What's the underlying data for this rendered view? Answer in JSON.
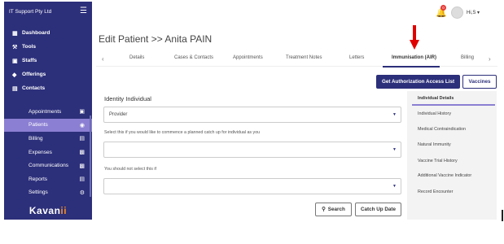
{
  "sidebar": {
    "org_name": "IT Support Pty Ltd",
    "top_items": [
      {
        "label": "Dashboard",
        "icon": "grid-icon"
      },
      {
        "label": "Tools",
        "icon": "wrench-icon"
      },
      {
        "label": "Staffs",
        "icon": "person-icon"
      },
      {
        "label": "Offerings",
        "icon": "box-icon"
      },
      {
        "label": "Contacts",
        "icon": "contact-icon"
      }
    ],
    "sub_items": [
      {
        "label": "Appointments",
        "icon": "calendar-icon",
        "active": false
      },
      {
        "label": "Patients",
        "icon": "users-icon",
        "active": true
      },
      {
        "label": "Billing",
        "icon": "card-icon",
        "active": false
      },
      {
        "label": "Expenses",
        "icon": "wallet-icon",
        "active": false
      },
      {
        "label": "Communications",
        "icon": "chat-icon",
        "active": false
      },
      {
        "label": "Reports",
        "icon": "report-icon",
        "active": false
      },
      {
        "label": "Settings",
        "icon": "gear-icon",
        "active": false
      }
    ],
    "logo_main": "Kavan",
    "logo_accent": "ii"
  },
  "header": {
    "notification_count": "0",
    "user_initials": "Hi,S"
  },
  "page": {
    "title": "Edit Patient >> Anita PAIN"
  },
  "tabs": [
    "Details",
    "Cases & Contacts",
    "Appointments",
    "Treatment Notes",
    "Letters",
    "Immunisation (AIR)",
    "Billing"
  ],
  "buttons": {
    "authorization": "Get Authorization Access List",
    "vaccines": "Vaccines",
    "search": "Search",
    "catch_up": "Catch Up Date"
  },
  "form": {
    "heading": "Identity Individual",
    "select1_value": "Provider",
    "help2": "Select this if you would like to commence a planned catch up for individual as you",
    "help3": "You should not select this if"
  },
  "right_panel": [
    "Individual Details",
    "Individual History",
    "Medical Contraindication",
    "Natural Immunity",
    "Vaccine Trial History",
    "Additional Vaccine Indicator",
    "Record Encounter"
  ],
  "colors": {
    "brand": "#2c2f7a",
    "accent": "#8b7fd3",
    "alert": "#e53935"
  }
}
